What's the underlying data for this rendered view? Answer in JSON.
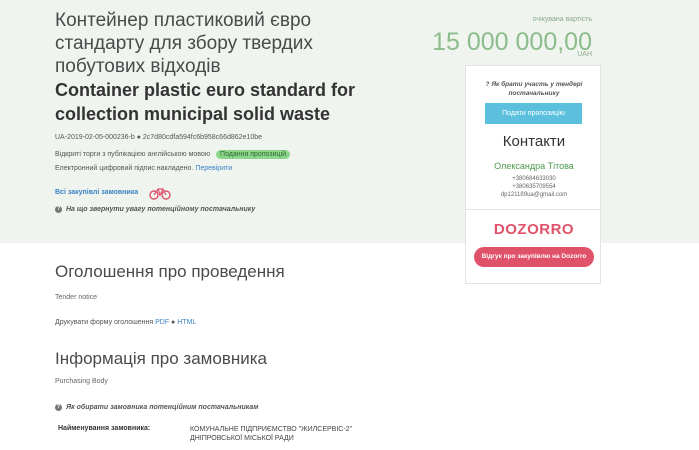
{
  "tender": {
    "title_ua": "Контейнер пластиковий євро стандарту для збору твердих побутових відходів",
    "title_en": "Container plastic euro standard for collection municipal solid waste",
    "id": "UA-2019-02-05-000236-b ● 2c7d80cdfa594fc6b958c66d862e10be",
    "open_trade": "Відкриті торги з публікацією англійською мовою",
    "status_badge": "Подання пропозицій",
    "signature_text": "Електронний цифровий підпис накладено.",
    "signature_link": "Перевірити",
    "all_purchases": "Всі закупівлі замовника",
    "hint_supplier": "На що звернути увагу потенційному постачальнику"
  },
  "price": {
    "label": "очікувана вартість",
    "value": "15 000 000,00",
    "currency": "UAH"
  },
  "sidebar": {
    "how_to": "Як брати участь у тендері постачальнику",
    "submit_label": "Подати пропозицію",
    "contacts_title": "Контакти",
    "contact_name": "Олександра Тітова",
    "phone1": "+380684633030",
    "phone2": "+380635709554",
    "email": "dp121189ua@gmail.com",
    "dozorro_logo": "DOZORRO",
    "feedback_label": "Відгук про закупівлю на Dozorro"
  },
  "notice": {
    "title": "Оголошення про проведення",
    "subtitle": "Tender notice",
    "print_text": "Друкувати форму оголошення",
    "pdf": "PDF",
    "sep": "●",
    "html": "HTML"
  },
  "buyer": {
    "title": "Інформація про замовника",
    "subtitle": "Purchasing Body",
    "hint": "Як обирати замовника потенційним постачальникам",
    "name_label": "Найменування замовника:",
    "name_value": "КОМУНАЛЬНЕ ПІДПРИЄМСТВО \"ЖИЛСЕРВІС-2\" ДНІПРОВСЬКОЇ МІСЬКОЇ РАДИ"
  },
  "colors": {
    "hero_bg": "#eff4ef",
    "accent_blue": "#5bc0de",
    "dozorro_red": "#e0526a",
    "price_green": "#8cbc8c"
  }
}
